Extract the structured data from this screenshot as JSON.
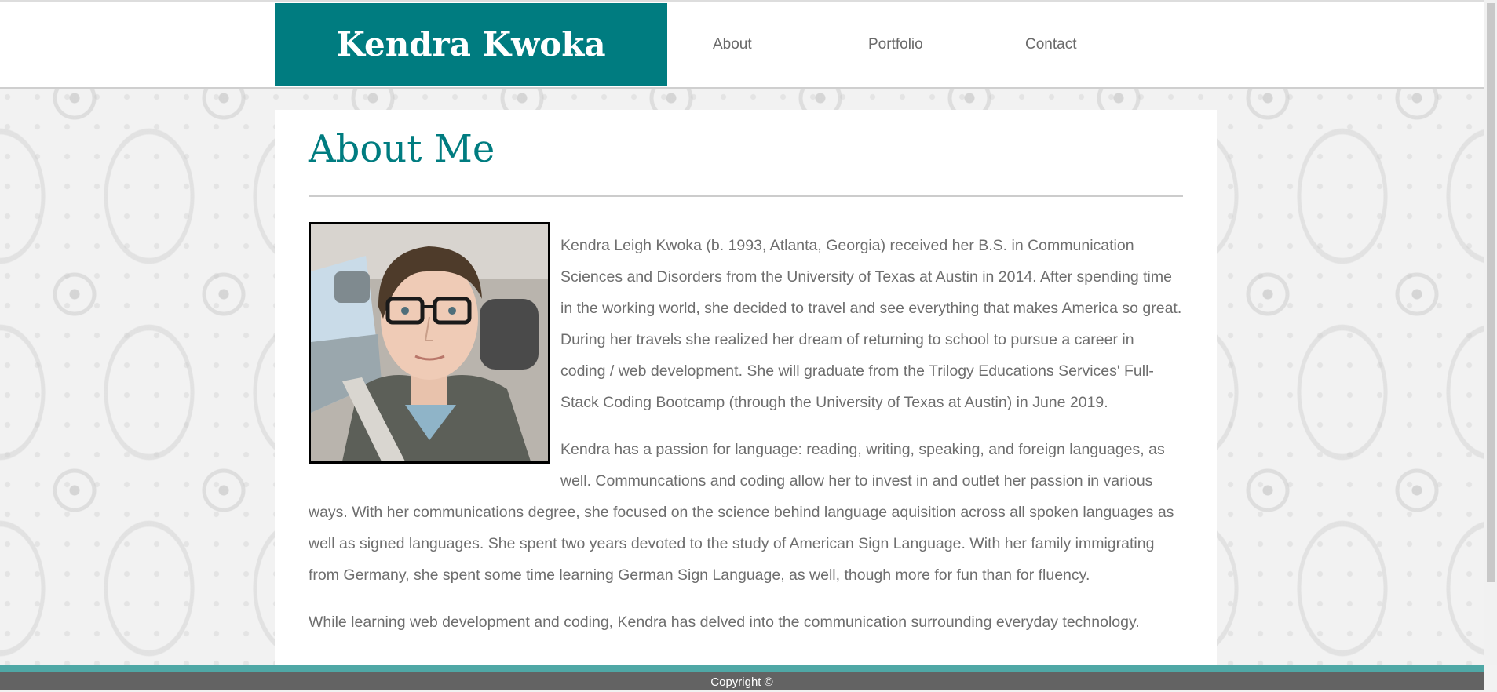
{
  "header": {
    "brand": "Kendra Kwoka",
    "nav": [
      {
        "label": "About"
      },
      {
        "label": "Portfolio"
      },
      {
        "label": "Contact"
      }
    ]
  },
  "main": {
    "title": "About Me",
    "paragraphs": [
      "Kendra Leigh Kwoka (b. 1993, Atlanta, Georgia) received her B.S. in Communication Sciences and Disorders from the University of Texas at Austin in 2014. After spending time in the working world, she decided to travel and see everything that makes America so great. During her travels she realized her dream of returning to school to pursue a career in coding / web development. She will graduate from the Trilogy Educations Services' Full-Stack Coding Bootcamp (through the University of Texas at Austin) in June 2019.",
      "Kendra has a passion for language: reading, writing, speaking, and foreign languages, as well. Communcations and coding allow her to invest in and outlet her passion in various ways. With her communications degree, she focused on the science behind language aquisition across all spoken languages as well as signed languages. She spent two years devoted to the study of American Sign Language. With her family immigrating from Germany, she spent some time learning German Sign Language, as well, though more for fun than for fluency.",
      "While learning web development and coding, Kendra has delved into the communication surrounding everyday technology."
    ]
  },
  "footer": {
    "copyright": "Copyright ©"
  },
  "colors": {
    "brand": "#007c80",
    "footer_stripe": "#4fa8a6",
    "footer": "#636363"
  }
}
